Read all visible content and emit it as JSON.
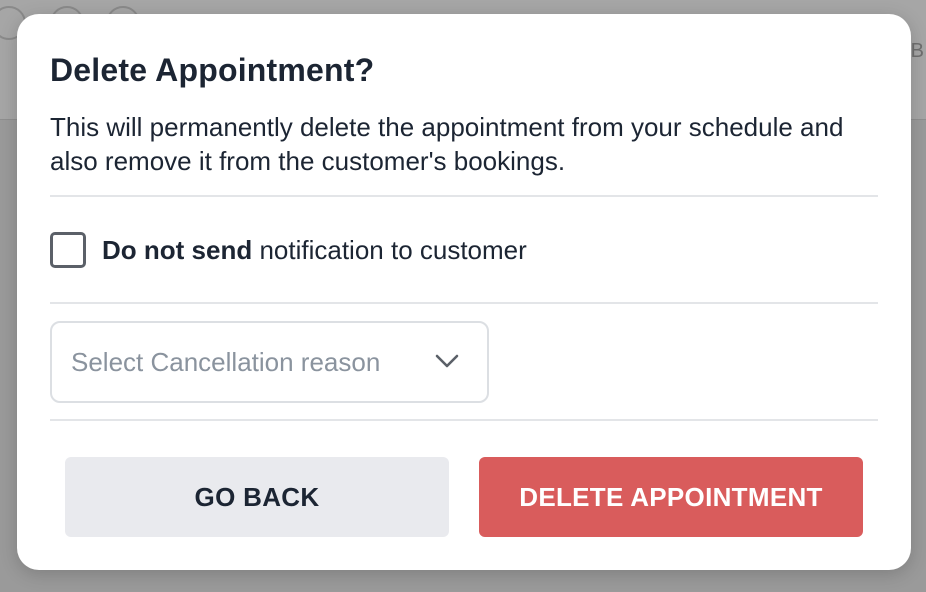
{
  "dialog": {
    "title": "Delete Appointment?",
    "description": "This will permanently delete the appointment from your schedule and also remove it from the customer's bookings.",
    "notify_checkbox": {
      "checked": false,
      "label_bold": "Do not send",
      "label_rest": " notification to customer"
    },
    "cancellation_select": {
      "placeholder": "Select Cancellation reason"
    },
    "buttons": {
      "back_label": "GO BACK",
      "delete_label": "DELETE APPOINTMENT"
    }
  },
  "background": {
    "partial_letter": "B"
  },
  "colors": {
    "danger": "#d95c5c",
    "secondary_button": "#e9eaee",
    "text": "#1c2533",
    "placeholder": "#8a939e"
  },
  "icons": {
    "select_chevron": "chevron-down-icon"
  }
}
